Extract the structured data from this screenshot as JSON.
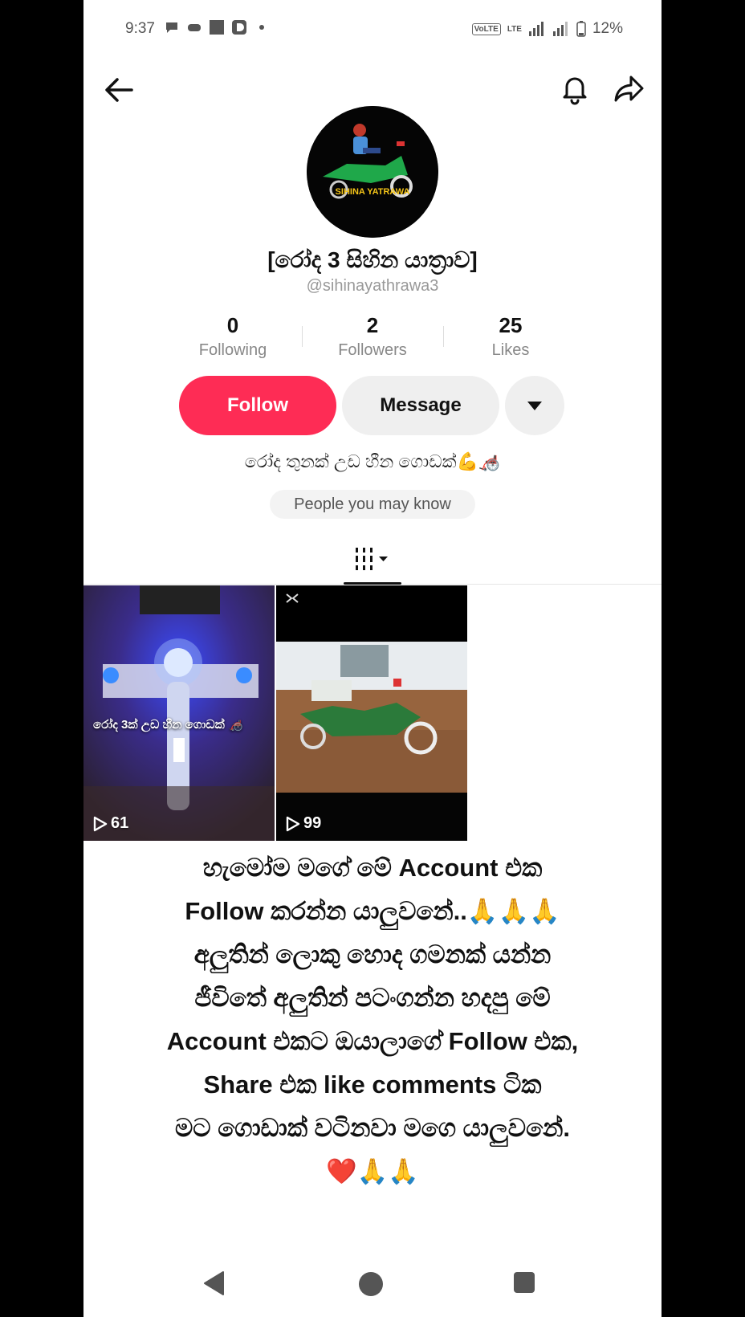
{
  "status_bar": {
    "time": "9:37",
    "volte": "VoLTE",
    "lte": "LTE",
    "battery": "12%",
    "left_icons": [
      "chat-bubble-icon",
      "gamepad-icon",
      "square-icon",
      "d-app-icon",
      "dot-icon"
    ]
  },
  "profile": {
    "display_name": "[රෝද 3 සිහින යාත්‍රාව]",
    "username": "@sihinayathrawa3",
    "avatar_text": "SIHINA YATRAWA",
    "bio": "රෝද තුනක් උඩ හීන ගොඩක්💪🦽"
  },
  "stats": [
    {
      "value": "0",
      "label": "Following"
    },
    {
      "value": "2",
      "label": "Followers"
    },
    {
      "value": "25",
      "label": "Likes"
    }
  ],
  "actions": {
    "follow": "Follow",
    "message": "Message"
  },
  "people_chip": "People you may know",
  "videos": [
    {
      "views": "61",
      "caption": "රෝද 3ක් උඩ හීන ගොඩක් 🦽"
    },
    {
      "views": "99"
    }
  ],
  "promo_lines": [
    "හැමෝම මගේ මේ Account එක",
    "Follow කරන්න යාලුවනේ..🙏🙏🙏",
    "අලුතින් ලොකු හොද ගමනක් යන්න",
    "ජීවිතේ අලුතින් පටංගන්න හදපු මේ",
    "Account එකට ඔයාලාගේ Follow එක,",
    "Share එක like comments ටික",
    "මට ගොඩාක් වටිනවා මගෙ යාලුවනේ.",
    "❤️🙏🙏"
  ],
  "colors": {
    "follow_bg": "#fe2c55",
    "chip_bg": "#f3f3f3"
  }
}
